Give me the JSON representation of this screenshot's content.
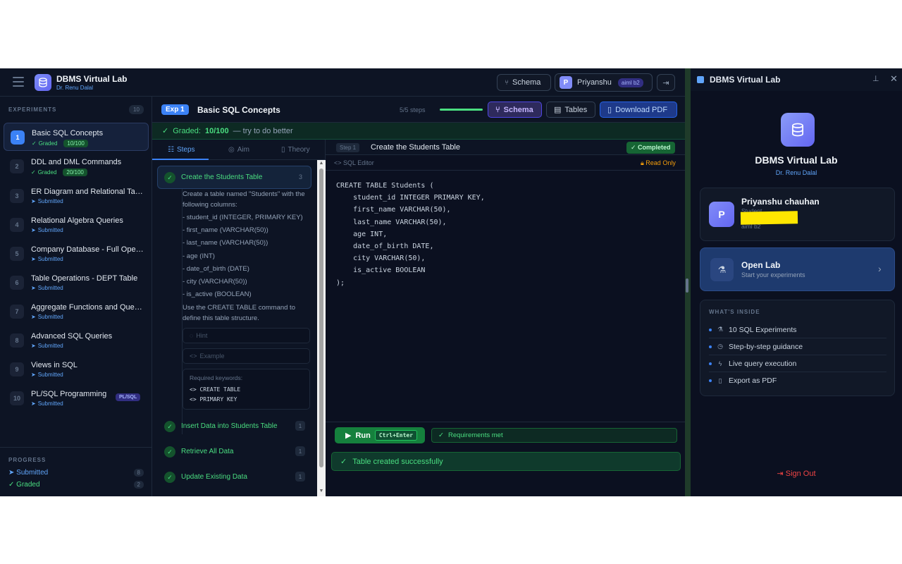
{
  "header": {
    "app_title": "DBMS Virtual Lab",
    "app_subtitle": "Dr. Renu Dalal",
    "schema_label": "Schema",
    "user_name": "Priyanshu",
    "user_initial": "P",
    "user_badge": "aiml b2"
  },
  "sidebar": {
    "heading": "EXPERIMENTS",
    "count": "10",
    "items": [
      {
        "num": "1",
        "title": "Basic SQL Concepts",
        "status": "Graded",
        "score": "10/100"
      },
      {
        "num": "2",
        "title": "DDL and DML Commands",
        "status": "Graded",
        "score": "20/100"
      },
      {
        "num": "3",
        "title": "ER Diagram and Relational Tables",
        "status": "Submitted"
      },
      {
        "num": "4",
        "title": "Relational Algebra Queries",
        "status": "Submitted"
      },
      {
        "num": "5",
        "title": "Company Database - Full Operat...",
        "status": "Submitted"
      },
      {
        "num": "6",
        "title": "Table Operations - DEPT Table",
        "status": "Submitted"
      },
      {
        "num": "7",
        "title": "Aggregate Functions and Queries",
        "status": "Submitted"
      },
      {
        "num": "8",
        "title": "Advanced SQL Queries",
        "status": "Submitted"
      },
      {
        "num": "9",
        "title": "Views in SQL",
        "status": "Submitted"
      },
      {
        "num": "10",
        "title": "PL/SQL Programming",
        "status": "Submitted",
        "badge": "PL/SQL"
      }
    ],
    "progress": {
      "heading": "PROGRESS",
      "submitted_label": "Submitted",
      "submitted_count": "8",
      "graded_label": "Graded",
      "graded_count": "2"
    }
  },
  "experiment": {
    "tag": "Exp 1",
    "title": "Basic SQL Concepts",
    "steps_label": "5/5 steps",
    "steps_progress": 1.0,
    "schema_btn": "Schema",
    "tables_btn": "Tables",
    "pdf_btn": "Download PDF",
    "graded_label": "Graded:",
    "graded_score": "10/100",
    "graded_note": "— try to do better"
  },
  "tabs": [
    {
      "label": "Steps"
    },
    {
      "label": "Aim"
    },
    {
      "label": "Theory"
    }
  ],
  "steps": {
    "active": {
      "title": "Create the Students Table",
      "num": "3",
      "description": [
        "Create a table named \"Students\" with the",
        "following columns:",
        "- student_id (INTEGER, PRIMARY KEY)",
        "- first_name (VARCHAR(50))",
        "- last_name (VARCHAR(50))",
        "- age (INT)",
        "- date_of_birth (DATE)",
        "- city (VARCHAR(50))",
        "- is_active (BOOLEAN)",
        "Use the CREATE TABLE command to",
        "define this table structure."
      ],
      "hint_label": "Hint",
      "example_label": "Example",
      "keywords_heading": "Required keywords:",
      "keywords": [
        "CREATE TABLE",
        "PRIMARY KEY"
      ]
    },
    "others": [
      {
        "title": "Insert Data into Students Table",
        "num": "1"
      },
      {
        "title": "Retrieve All Data",
        "num": "1"
      },
      {
        "title": "Update Existing Data",
        "num": "1"
      }
    ]
  },
  "editor": {
    "step_tag": "Step 1",
    "step_title": "Create the Students Table",
    "completed": "✓ Completed",
    "sub_label": "SQL Editor",
    "readonly": "Read Only",
    "code": "CREATE TABLE Students (\n    student_id INTEGER PRIMARY KEY,\n    first_name VARCHAR(50),\n    last_name VARCHAR(50),\n    age INT,\n    date_of_birth DATE,\n    city VARCHAR(50),\n    is_active BOOLEAN\n);",
    "run_label": "Run",
    "run_shortcut": "Ctrl+Enter",
    "requirements": "Requirements met",
    "result": "Table created successfully"
  },
  "side_window": {
    "title": "DBMS Virtual Lab",
    "brand_title": "DBMS Virtual Lab",
    "brand_sub": "Dr. Renu Dalal",
    "user_name": "Priyanshu chauhan",
    "user_initial": "P",
    "user_role": "Student",
    "user_class": "aiml b2",
    "open_title": "Open Lab",
    "open_sub": "Start your experiments",
    "inside_heading": "WHAT'S INSIDE",
    "features": [
      "10 SQL Experiments",
      "Step-by-step guidance",
      "Live query execution",
      "Export as PDF"
    ],
    "signout": "Sign Out"
  }
}
